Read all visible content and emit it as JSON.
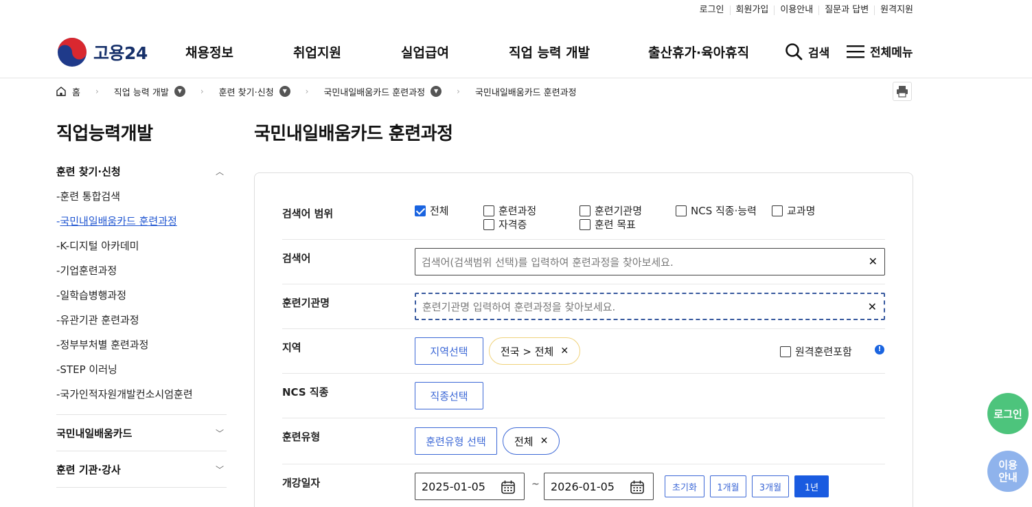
{
  "util_links": [
    "로그인",
    "회원가입",
    "이용안내",
    "질문과 답변",
    "원격지원"
  ],
  "logo_text": "고용24",
  "gnb": [
    "채용정보",
    "취업지원",
    "실업급여",
    "직업 능력 개발",
    "출산휴가·육아휴직"
  ],
  "header": {
    "search_label": "검색",
    "menu_label": "전체메뉴"
  },
  "breadcrumb": [
    "홈",
    "직업 능력 개발",
    "훈련 찾기·신청",
    "국민내일배움카드 훈련과정",
    "국민내일배움카드 훈련과정"
  ],
  "sidebar": {
    "title": "직업능력개발",
    "group1": "훈련 찾기·신청",
    "items": [
      "훈련 통합검색",
      "국민내일배움카드 훈련과정",
      "K-디지털 아카데미",
      "기업훈련과정",
      "일학습병행과정",
      "유관기관 훈련과정",
      "정부부처별 훈련과정",
      "STEP 이러닝",
      "국가인적자원개발컨소시엄훈련"
    ],
    "group2": "국민내일배움카드",
    "group3": "훈련 기관·강사"
  },
  "content": {
    "title": "국민내일배움카드 훈련과정",
    "labels": {
      "scope": "검색어 범위",
      "keyword": "검색어",
      "institution": "훈련기관명",
      "region": "지역",
      "ncs": "NCS 직종",
      "type": "훈련유형",
      "date": "개강일자"
    },
    "scope_options": [
      "전체",
      "훈련과정",
      "훈련기관명",
      "NCS 직종·능력",
      "교과명",
      "자격증",
      "훈련 목표"
    ],
    "keyword_placeholder": "검색어(검색범위 선택)를 입력하여 훈련과정을 찾아보세요.",
    "institution_placeholder": "훈련기관명 입력하여 훈련과정을 찾아보세요.",
    "region_button": "지역선택",
    "region_chip": "전국 > 전체",
    "remote_label": "원격훈련포함",
    "ncs_button": "직종선택",
    "type_button": "훈련유형 선택",
    "type_chip": "전체",
    "date_from": "2025-01-05",
    "date_to": "2026-01-05",
    "date_sep": "~",
    "period_buttons": [
      "초기화",
      "1개월",
      "3개월",
      "1년"
    ]
  },
  "floating": {
    "login": "로그인",
    "guide_line1": "이용",
    "guide_line2": "안내"
  },
  "colors": {
    "primary": "#1a64e0",
    "outline": "#3b67d6",
    "login_float": "#4dc47c",
    "guide_float": "#8fb3ec"
  }
}
